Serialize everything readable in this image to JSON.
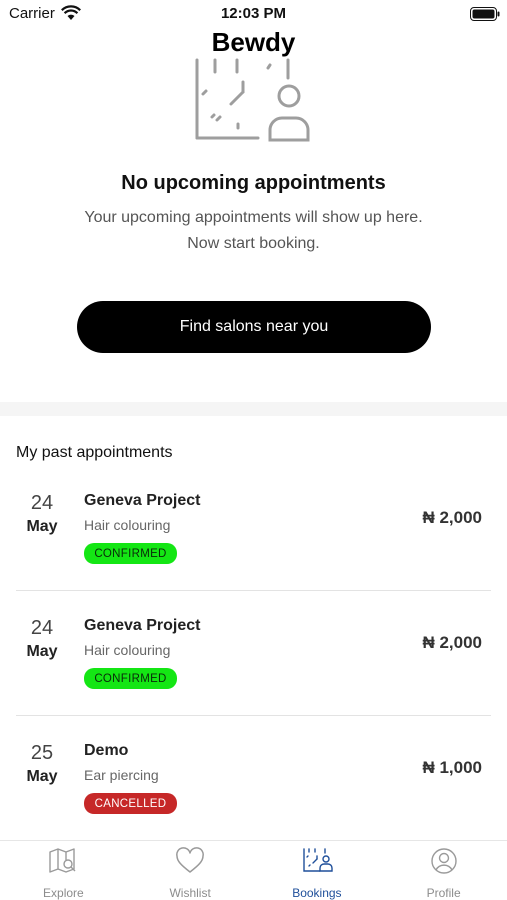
{
  "status_bar": {
    "carrier": "Carrier",
    "time": "12:03 PM"
  },
  "app": {
    "title": "Bewdy"
  },
  "empty_state": {
    "illustration_icon": "calendar-person-icon",
    "title": "No upcoming appointments",
    "subtitle_line1": "Your upcoming appointments will show up here.",
    "subtitle_line2": "Now start booking.",
    "cta_label": "Find salons near you"
  },
  "past": {
    "title": "My past appointments",
    "appointments": [
      {
        "day": "24",
        "month": "May",
        "salon": "Geneva Project",
        "service": "Hair colouring",
        "status": "CONFIRMED",
        "price": "₦ 2,000"
      },
      {
        "day": "24",
        "month": "May",
        "salon": "Geneva Project",
        "service": "Hair colouring",
        "status": "CONFIRMED",
        "price": "₦ 2,000"
      },
      {
        "day": "25",
        "month": "May",
        "salon": "Demo",
        "service": "Ear piercing",
        "status": "CANCELLED",
        "price": "₦ 1,000"
      }
    ]
  },
  "colors": {
    "confirmed": "#14e614",
    "cancelled": "#c62828",
    "active_tab": "#1f4f9a",
    "cta_background": "#000000"
  },
  "tabbar": {
    "active": "Bookings",
    "tabs": [
      {
        "label": "Explore",
        "icon": "map-search-icon"
      },
      {
        "label": "Wishlist",
        "icon": "heart-icon"
      },
      {
        "label": "Bookings",
        "icon": "calendar-person-icon"
      },
      {
        "label": "Profile",
        "icon": "user-circle-icon"
      }
    ]
  }
}
